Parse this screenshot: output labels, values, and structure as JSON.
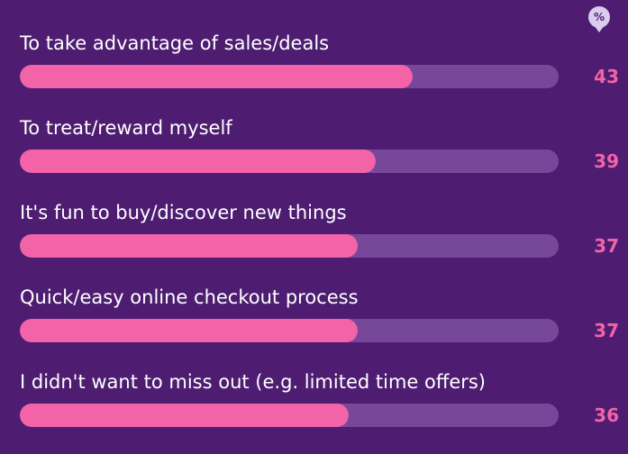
{
  "chart_data": {
    "type": "bar",
    "orientation": "horizontal",
    "unit": "%",
    "categories": [
      "To take advantage of sales/deals",
      "To treat/reward myself",
      "It's fun to buy/discover new things",
      "Quick/easy online checkout process",
      "I didn't want to miss out (e.g. limited time offers)"
    ],
    "values": [
      43,
      39,
      37,
      37,
      36
    ],
    "xlim": [
      0,
      59
    ],
    "colors": {
      "background": "#4e1d72",
      "bar": "#f263a8",
      "track": "#77479a",
      "label": "#ffffff",
      "value": "#f263a8",
      "badge": "#d8cdee"
    }
  }
}
